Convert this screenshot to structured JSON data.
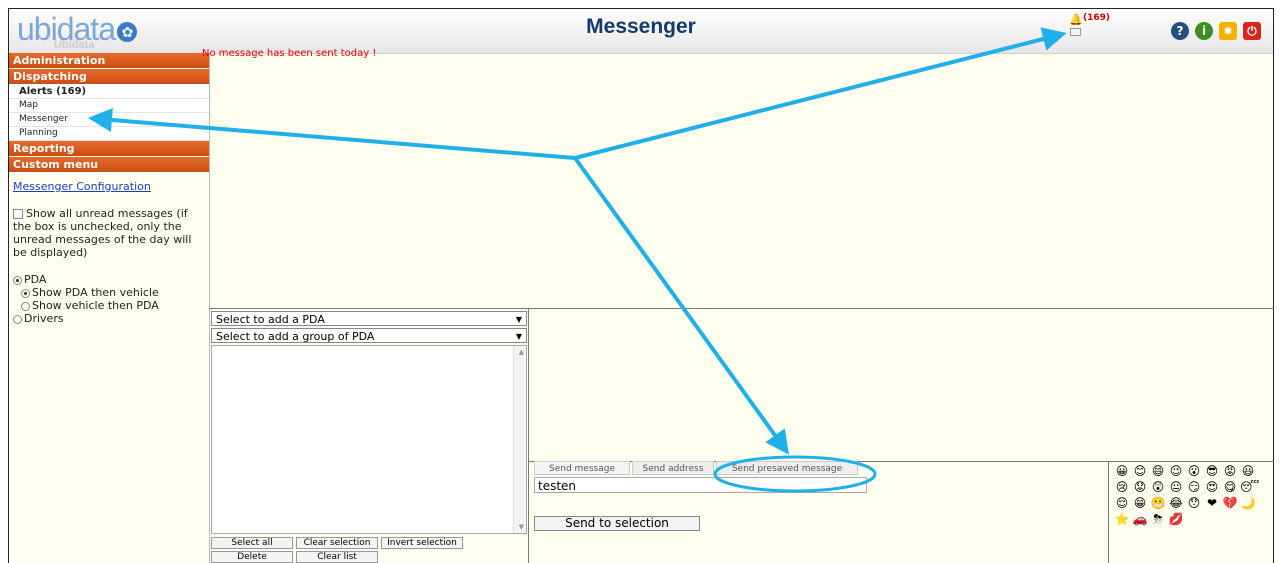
{
  "header": {
    "logo": "ubidata",
    "logo_sub": "Ubidata",
    "title": "Messenger",
    "alerts_badge": "(169)"
  },
  "sidebar": {
    "sections": [
      {
        "label": "Administration"
      },
      {
        "label": "Dispatching"
      }
    ],
    "dispatching_items": [
      {
        "label": "Alerts (169)"
      },
      {
        "label": "Map"
      },
      {
        "label": "Messenger"
      },
      {
        "label": "Planning"
      }
    ],
    "reporting": "Reporting",
    "custom_menu": "Custom menu",
    "config_link": "Messenger Configuration",
    "show_unread": "Show all unread messages (if the box is unchecked, only the unread messages of the day will be displayed)",
    "radio_pda": "PDA",
    "radio_pda_vehicle": "Show PDA then vehicle",
    "radio_vehicle_pda": "Show vehicle then PDA",
    "radio_drivers": "Drivers"
  },
  "main": {
    "no_message": "No message has been sent today !",
    "select_pda": "Select to add a PDA",
    "select_group": "Select to add a group of PDA",
    "btn_select_all": "Select all",
    "btn_clear_selection": "Clear selection",
    "btn_invert_selection": "Invert selection",
    "btn_delete": "Delete",
    "btn_clear_list": "Clear list",
    "tabs": [
      {
        "label": "Send message"
      },
      {
        "label": "Send address"
      },
      {
        "label": "Send presaved message"
      }
    ],
    "presaved_value": "testen",
    "send_button": "Send to selection"
  },
  "emojis": [
    "😀",
    "😊",
    "😄",
    "😉",
    "😮",
    "😎",
    "😡",
    "😃",
    "😢",
    "😟",
    "😲",
    "😐",
    "😏",
    "😍",
    "😋",
    "😴",
    "😌",
    "😁",
    "😬",
    "😂",
    "😯",
    "❤",
    "💔",
    "🌙",
    "⭐",
    "🚗",
    "⛈",
    "💋"
  ],
  "colors": {
    "nav_orange": "#d65c1f",
    "annotation_arrow": "#1fb0ea",
    "error_red": "#e00000"
  }
}
